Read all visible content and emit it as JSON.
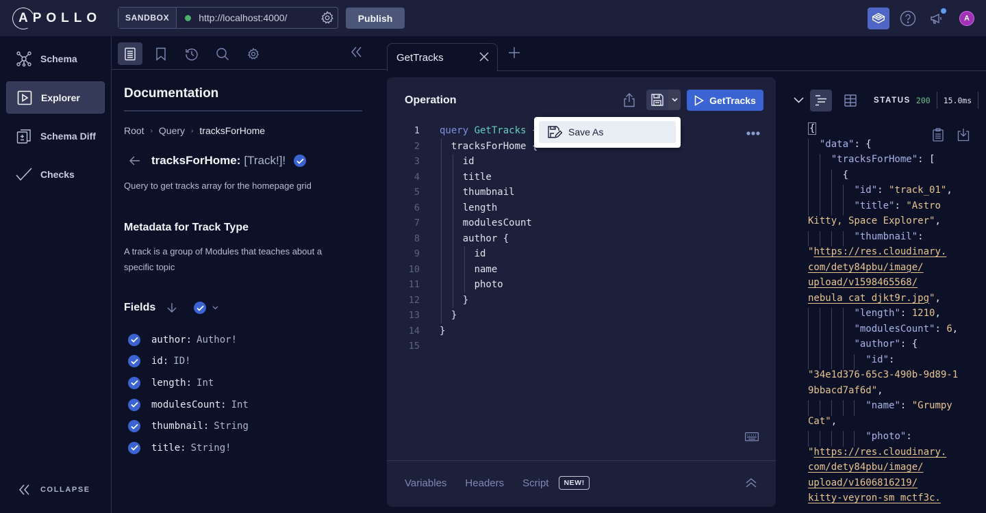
{
  "topbar": {
    "logo": "APOLLO",
    "sandbox_label": "SANDBOX",
    "endpoint_url": "http://localhost:4000/",
    "endpoint_status_color": "#4caf6a",
    "publish_label": "Publish"
  },
  "leftnav": {
    "items": [
      {
        "label": "Schema",
        "icon": "schema-graph-icon",
        "active": false
      },
      {
        "label": "Explorer",
        "icon": "play-square-icon",
        "active": true
      },
      {
        "label": "Schema Diff",
        "icon": "diff-icon",
        "active": false
      },
      {
        "label": "Checks",
        "icon": "checkmark-icon",
        "active": false
      }
    ],
    "collapse_label": "COLLAPSE"
  },
  "docs": {
    "toolbar": [
      "documentation-icon",
      "bookmark-icon",
      "history-icon",
      "search-icon",
      "settings-icon"
    ],
    "title": "Documentation",
    "breadcrumb": [
      "Root",
      "Query",
      "tracksForHome"
    ],
    "field_name": "tracksForHome:",
    "field_type": "[Track!]!",
    "field_description": "Query to get tracks array for the homepage grid",
    "metadata_title": "Metadata for Track Type",
    "metadata_description": "A track is a group of Modules that teaches about a specific topic",
    "fields_title": "Fields",
    "fields": [
      {
        "name": "author:",
        "type": "Author!",
        "checked": true
      },
      {
        "name": "id:",
        "type": "ID!",
        "checked": true
      },
      {
        "name": "length:",
        "type": "Int",
        "checked": true
      },
      {
        "name": "modulesCount:",
        "type": "Int",
        "checked": true
      },
      {
        "name": "thumbnail:",
        "type": "String",
        "checked": true
      },
      {
        "name": "title:",
        "type": "String!",
        "checked": true
      }
    ]
  },
  "tabs": [
    {
      "label": "GetTracks",
      "active": true
    }
  ],
  "operation": {
    "title": "Operation",
    "run_label": "GetTracks",
    "save_menu": {
      "item_label": "Save As"
    },
    "lines": [
      {
        "n": "1",
        "kw": "query",
        "name": "GetTracks",
        "text": ""
      },
      {
        "n": "2",
        "text": "  tracksForHome {"
      },
      {
        "n": "3",
        "text": "    id"
      },
      {
        "n": "4",
        "text": "    title"
      },
      {
        "n": "5",
        "text": "    thumbnail"
      },
      {
        "n": "6",
        "text": "    length"
      },
      {
        "n": "7",
        "text": "    modulesCount"
      },
      {
        "n": "8",
        "text": "    author {"
      },
      {
        "n": "9",
        "text": "      id"
      },
      {
        "n": "10",
        "text": "      name"
      },
      {
        "n": "11",
        "text": "      photo"
      },
      {
        "n": "12",
        "text": "    }"
      },
      {
        "n": "13",
        "text": "  }"
      },
      {
        "n": "14",
        "text": "}"
      },
      {
        "n": "15",
        "text": ""
      }
    ],
    "bottom_tabs": [
      "Variables",
      "Headers",
      "Script"
    ],
    "new_badge": "NEW!"
  },
  "response": {
    "status_label": "STATUS",
    "status_code": "200",
    "status_code_color": "#6cc38a",
    "time": "15.0ms",
    "lines": [
      {
        "g": 0,
        "parts": [
          [
            "brace",
            "{"
          ]
        ]
      },
      {
        "g": 1,
        "indent": "  ",
        "parts": [
          [
            "k",
            "\"data\""
          ],
          [
            "p",
            ": {"
          ]
        ]
      },
      {
        "g": 2,
        "indent": "    ",
        "parts": [
          [
            "k",
            "\"tracksForHome\""
          ],
          [
            "p",
            ": ["
          ]
        ]
      },
      {
        "g": 3,
        "indent": "      ",
        "parts": [
          [
            "p",
            "{"
          ]
        ]
      },
      {
        "g": 4,
        "indent": "        ",
        "parts": [
          [
            "k",
            "\"id\""
          ],
          [
            "p",
            ": "
          ],
          [
            "s",
            "\"track_01\""
          ],
          [
            "p",
            ","
          ]
        ]
      },
      {
        "g": 4,
        "indent": "        ",
        "parts": [
          [
            "k",
            "\"title\""
          ],
          [
            "p",
            ": "
          ],
          [
            "s",
            "\"Astro"
          ]
        ]
      },
      {
        "g": 0,
        "indent": "",
        "parts": [
          [
            "s",
            "Kitty, Space Explorer\""
          ],
          [
            "p",
            ","
          ]
        ]
      },
      {
        "g": 4,
        "indent": "        ",
        "parts": [
          [
            "k",
            "\"thumbnail\""
          ],
          [
            "p",
            ":"
          ]
        ]
      },
      {
        "g": 0,
        "indent": "",
        "parts": [
          [
            "s",
            "\""
          ],
          [
            "u",
            "https://res.cloudinary."
          ]
        ]
      },
      {
        "g": 0,
        "indent": "",
        "parts": [
          [
            "u",
            "com/dety84pbu/image/"
          ]
        ]
      },
      {
        "g": 0,
        "indent": "",
        "parts": [
          [
            "u",
            "upload/v1598465568/"
          ]
        ]
      },
      {
        "g": 0,
        "indent": "",
        "parts": [
          [
            "u",
            "nebula_cat_djkt9r.jpg"
          ],
          [
            "s",
            "\""
          ],
          [
            "p",
            ","
          ]
        ]
      },
      {
        "g": 4,
        "indent": "        ",
        "parts": [
          [
            "k",
            "\"length\""
          ],
          [
            "p",
            ": "
          ],
          [
            "n",
            "1210"
          ],
          [
            "p",
            ","
          ]
        ]
      },
      {
        "g": 4,
        "indent": "        ",
        "parts": [
          [
            "k",
            "\"modulesCount\""
          ],
          [
            "p",
            ": "
          ],
          [
            "n",
            "6"
          ],
          [
            "p",
            ","
          ]
        ]
      },
      {
        "g": 4,
        "indent": "        ",
        "parts": [
          [
            "k",
            "\"author\""
          ],
          [
            "p",
            ": {"
          ]
        ]
      },
      {
        "g": 5,
        "indent": "          ",
        "parts": [
          [
            "k",
            "\"id\""
          ],
          [
            "p",
            ":"
          ]
        ]
      },
      {
        "g": 0,
        "indent": "",
        "parts": [
          [
            "s",
            "\"34e1d376-65c3-490b-9d89-1"
          ]
        ]
      },
      {
        "g": 0,
        "indent": "",
        "parts": [
          [
            "s",
            "9bbacd7af6d\""
          ],
          [
            "p",
            ","
          ]
        ]
      },
      {
        "g": 5,
        "indent": "          ",
        "parts": [
          [
            "k",
            "\"name\""
          ],
          [
            "p",
            ": "
          ],
          [
            "s",
            "\"Grumpy"
          ]
        ]
      },
      {
        "g": 0,
        "indent": "",
        "parts": [
          [
            "s",
            "Cat\""
          ],
          [
            "p",
            ","
          ]
        ]
      },
      {
        "g": 5,
        "indent": "          ",
        "parts": [
          [
            "k",
            "\"photo\""
          ],
          [
            "p",
            ":"
          ]
        ]
      },
      {
        "g": 0,
        "indent": "",
        "parts": [
          [
            "s",
            "\""
          ],
          [
            "u",
            "https://res.cloudinary."
          ]
        ]
      },
      {
        "g": 0,
        "indent": "",
        "parts": [
          [
            "u",
            "com/dety84pbu/image/"
          ]
        ]
      },
      {
        "g": 0,
        "indent": "",
        "parts": [
          [
            "u",
            "upload/v1606816219/"
          ]
        ]
      },
      {
        "g": 0,
        "indent": "",
        "parts": [
          [
            "u",
            "kitty-veyron-sm_mctf3c."
          ]
        ]
      }
    ]
  },
  "colors": {
    "accent": "#3b63d1",
    "background": "#0c1128",
    "panel": "#1c203a"
  }
}
